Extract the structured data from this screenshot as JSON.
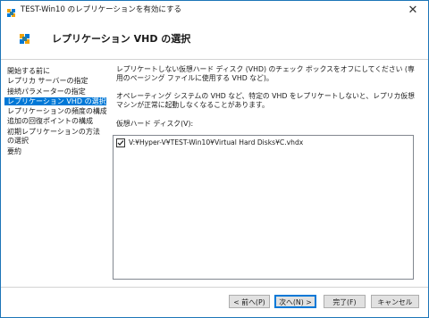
{
  "window": {
    "title": "TEST-Win10 のレプリケーションを有効にする",
    "close_glyph": "✕"
  },
  "header": {
    "title": "レプリケーション VHD の選択"
  },
  "nav": {
    "items": [
      {
        "label": "開始する前に"
      },
      {
        "label": "レプリカ サーバーの指定"
      },
      {
        "label": "接続パラメーターの指定"
      },
      {
        "label": "レプリケーション VHD の選択"
      },
      {
        "label": "レプリケーションの頻度の構成"
      },
      {
        "label": "追加の回復ポイントの構成"
      },
      {
        "label": "初期レプリケーションの方法の選択"
      },
      {
        "label": "要約"
      }
    ],
    "active_index": 3
  },
  "content": {
    "paragraph1": "レプリケートしない仮想ハード ディスク (VHD) のチェック ボックスをオフにしてください (専用のページング ファイルに使用する VHD など)。",
    "paragraph2": "オペレーティング システムの VHD など、特定の VHD をレプリケートしないと、レプリカ仮想マシンが正常に起動しなくなることがあります。",
    "list_label": "仮想ハード ディスク(V):",
    "vhds": [
      {
        "path": "V:¥Hyper-V¥TEST-Win10¥Virtual Hard Disks¥C.vhdx",
        "checked": true
      }
    ]
  },
  "buttons": {
    "prev": "< 前へ(P)",
    "next": "次へ(N) >",
    "finish": "完了(F)",
    "cancel": "キャンセル"
  },
  "colors": {
    "accent": "#0078d7",
    "window_border": "#1d75b8"
  }
}
